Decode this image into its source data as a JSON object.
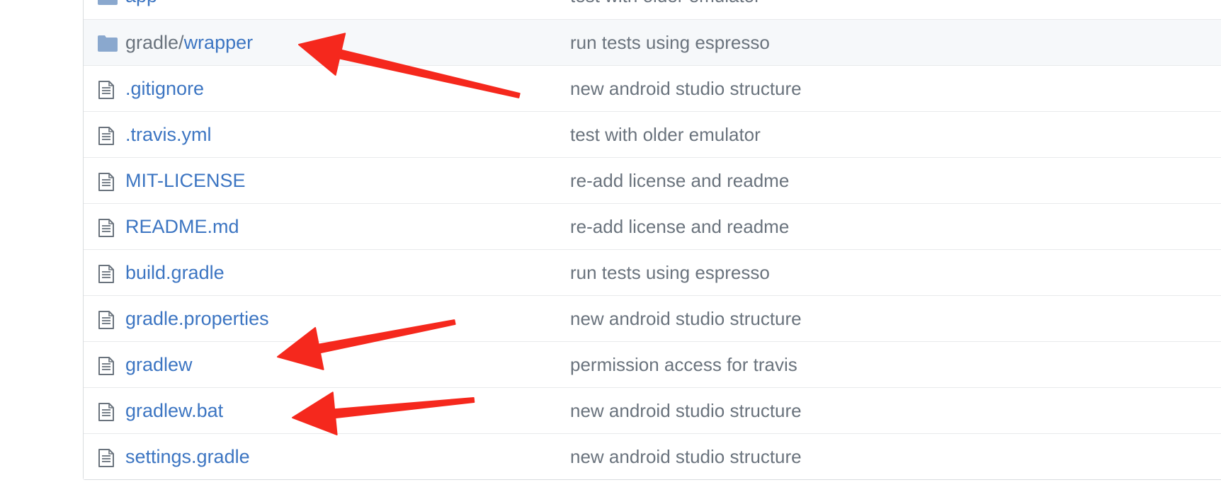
{
  "file_list": {
    "rows": [
      {
        "type": "folder",
        "icon": "folder-icon",
        "name_prefix": "",
        "name": "app",
        "message": "test with older emulator",
        "highlighted": false
      },
      {
        "type": "folder",
        "icon": "folder-icon",
        "name_prefix": "gradle/",
        "name": "wrapper",
        "message": "run tests using espresso",
        "highlighted": true
      },
      {
        "type": "file",
        "icon": "file-icon",
        "name_prefix": "",
        "name": ".gitignore",
        "message": "new android studio structure",
        "highlighted": false
      },
      {
        "type": "file",
        "icon": "file-icon",
        "name_prefix": "",
        "name": ".travis.yml",
        "message": "test with older emulator",
        "highlighted": false
      },
      {
        "type": "file",
        "icon": "file-icon",
        "name_prefix": "",
        "name": "MIT-LICENSE",
        "message": "re-add license and readme",
        "highlighted": false
      },
      {
        "type": "file",
        "icon": "file-icon",
        "name_prefix": "",
        "name": "README.md",
        "message": "re-add license and readme",
        "highlighted": false
      },
      {
        "type": "file",
        "icon": "file-icon",
        "name_prefix": "",
        "name": "build.gradle",
        "message": "run tests using espresso",
        "highlighted": false
      },
      {
        "type": "file",
        "icon": "file-icon",
        "name_prefix": "",
        "name": "gradle.properties",
        "message": "new android studio structure",
        "highlighted": false
      },
      {
        "type": "file",
        "icon": "file-icon",
        "name_prefix": "",
        "name": "gradlew",
        "message": "permission access for travis",
        "highlighted": false
      },
      {
        "type": "file",
        "icon": "file-icon",
        "name_prefix": "",
        "name": "gradlew.bat",
        "message": "new android studio structure",
        "highlighted": false
      },
      {
        "type": "file",
        "icon": "file-icon",
        "name_prefix": "",
        "name": "settings.gradle",
        "message": "new android studio structure",
        "highlighted": false
      }
    ]
  },
  "annotations": {
    "arrow_color": "#f5281d",
    "arrows": [
      {
        "points_to": "gradle/wrapper"
      },
      {
        "points_to": "gradle.properties / gradlew"
      },
      {
        "points_to": "gradlew.bat"
      }
    ]
  },
  "colors": {
    "link": "#3c75c2",
    "muted_text": "#6a737d",
    "folder_icon": "#8aa8ce",
    "file_icon": "#6a737d",
    "row_highlight": "#f6f8fa",
    "border": "#e8eaec"
  }
}
